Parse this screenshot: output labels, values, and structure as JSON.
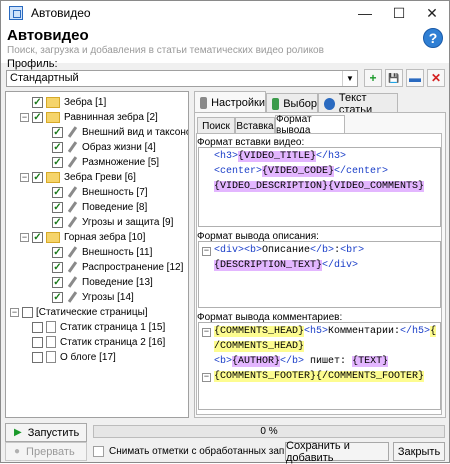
{
  "window": {
    "title": "Автовидео",
    "controls": {
      "minimize": "—",
      "maximize": "☐",
      "close": "✕"
    }
  },
  "header": {
    "title": "Автовидео",
    "subtitle": "Поиск, загрузка и добавления в статьи тематических видео роликов",
    "help": "?"
  },
  "profile": {
    "label": "Профиль:",
    "value": "Стандартный",
    "buttons": {
      "add": "+",
      "save": "💾",
      "edit": "▬",
      "delete": "✕"
    }
  },
  "tree": {
    "nodes": [
      {
        "label": "Зебра [1]",
        "level": 1,
        "icon": "folder",
        "checked": true,
        "expander": ""
      },
      {
        "label": "Равнинная зебра [2]",
        "level": 1,
        "icon": "folder",
        "checked": true,
        "expander": "−"
      },
      {
        "label": "Внешний вид и таксономия [3]",
        "level": 2,
        "icon": "pencil",
        "checked": true,
        "expander": ""
      },
      {
        "label": "Образ жизни [4]",
        "level": 2,
        "icon": "pencil",
        "checked": true,
        "expander": ""
      },
      {
        "label": "Размножение [5]",
        "level": 2,
        "icon": "pencil",
        "checked": true,
        "expander": ""
      },
      {
        "label": "Зебра Греви [6]",
        "level": 1,
        "icon": "folder",
        "checked": true,
        "expander": "−"
      },
      {
        "label": "Внешность [7]",
        "level": 2,
        "icon": "pencil",
        "checked": true,
        "expander": ""
      },
      {
        "label": "Поведение [8]",
        "level": 2,
        "icon": "pencil",
        "checked": true,
        "expander": ""
      },
      {
        "label": "Угрозы и защита [9]",
        "level": 2,
        "icon": "pencil",
        "checked": true,
        "expander": ""
      },
      {
        "label": "Горная зебра [10]",
        "level": 1,
        "icon": "folder",
        "checked": true,
        "expander": "−"
      },
      {
        "label": "Внешность [11]",
        "level": 2,
        "icon": "pencil",
        "checked": true,
        "expander": ""
      },
      {
        "label": "Распространение [12]",
        "level": 2,
        "icon": "pencil",
        "checked": true,
        "expander": ""
      },
      {
        "label": "Поведение [13]",
        "level": 2,
        "icon": "pencil",
        "checked": true,
        "expander": ""
      },
      {
        "label": "Угрозы [14]",
        "level": 2,
        "icon": "pencil",
        "checked": true,
        "expander": ""
      },
      {
        "label": "[Статические страницы]",
        "level": 0,
        "icon": "none",
        "checked": false,
        "expander": "−"
      },
      {
        "label": "Статик страница 1 [15]",
        "level": 1,
        "icon": "doc",
        "checked": false,
        "expander": ""
      },
      {
        "label": "Статик страница 2 [16]",
        "level": 1,
        "icon": "doc",
        "checked": false,
        "expander": ""
      },
      {
        "label": "О блоге [17]",
        "level": 1,
        "icon": "doc",
        "checked": false,
        "expander": ""
      }
    ]
  },
  "tabs": {
    "settings": "Настройки",
    "selection": "Выбор",
    "article_text": "Текст статьи"
  },
  "subtabs": {
    "search": "Поиск",
    "insert": "Вставка",
    "output_format": "Формат вывода"
  },
  "sections": {
    "video_format": {
      "label": "Формат вставки видео:",
      "lines": [
        [
          {
            "t": "<h3>",
            "c": "tag"
          },
          {
            "t": "{VIDEO_TITLE}",
            "c": "hl"
          },
          {
            "t": "</h3>",
            "c": "tag"
          }
        ],
        [
          {
            "t": "<center>",
            "c": "tag"
          },
          {
            "t": "{VIDEO_CODE}",
            "c": "hl"
          },
          {
            "t": "</center>",
            "c": "tag"
          }
        ],
        [
          {
            "t": "{VIDEO_DESCRIPTION}{VIDEO_COMMENTS}",
            "c": "hl"
          }
        ]
      ]
    },
    "description_format": {
      "label": "Формат вывода описания:",
      "lines": [
        [
          {
            "t": "<div>",
            "c": "tag"
          },
          {
            "t": "<b>",
            "c": "tag"
          },
          {
            "t": "Описание",
            "c": "txt"
          },
          {
            "t": "</b>",
            "c": "tag"
          },
          {
            "t": ":",
            "c": "txt"
          },
          {
            "t": "<br>",
            "c": "tag"
          }
        ],
        [
          {
            "t": "{DESCRIPTION_TEXT}",
            "c": "hl"
          },
          {
            "t": "</div>",
            "c": "tag"
          }
        ]
      ]
    },
    "comments_format": {
      "label": "Формат вывода комментариев:",
      "lines": [
        [
          {
            "t": "{COMMENTS_HEAD}",
            "c": "hly"
          },
          {
            "t": "<h5>",
            "c": "tag"
          },
          {
            "t": "Комментарии:",
            "c": "txt"
          },
          {
            "t": "</h5>",
            "c": "tag"
          },
          {
            "t": "{",
            "c": "hly"
          }
        ],
        [
          {
            "t": "/COMMENTS_HEAD}",
            "c": "hly"
          }
        ],
        [
          {
            "t": "<b>",
            "c": "tag"
          },
          {
            "t": "{AUTHOR}",
            "c": "hl"
          },
          {
            "t": "</b>",
            "c": "tag"
          },
          {
            "t": " пишет: ",
            "c": "txt"
          },
          {
            "t": "{TEXT}",
            "c": "hl"
          }
        ],
        [
          {
            "t": "{COMMENTS_FOOTER}{/COMMENTS_FOOTER}",
            "c": "hly"
          }
        ]
      ]
    }
  },
  "bottom": {
    "start": "Запустить",
    "stop": "Прервать",
    "progress": "0 %",
    "progress_value": 0,
    "uncheck_processed": "Снимать отметки с обработанных записей",
    "save_and_add": "Сохранить и добавить",
    "close": "Закрыть"
  }
}
